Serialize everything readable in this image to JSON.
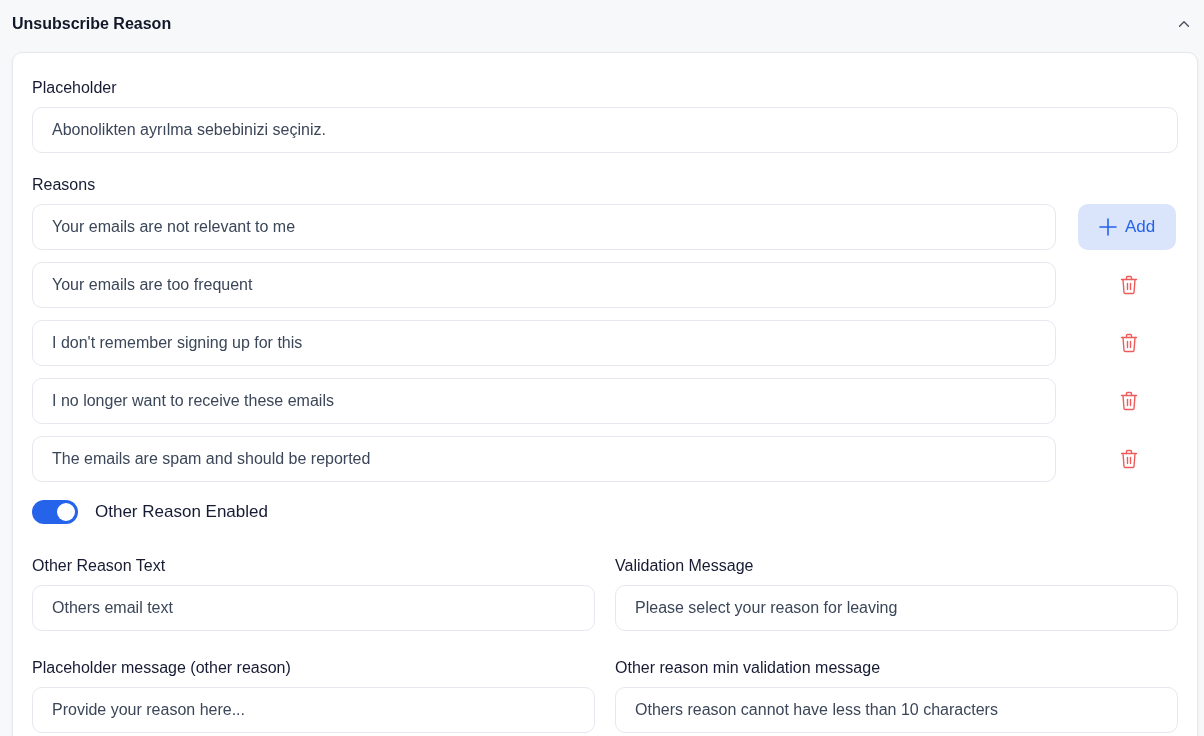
{
  "section": {
    "title": "Unsubscribe Reason",
    "expanded": true
  },
  "placeholder_field": {
    "label": "Placeholder",
    "value": "Abonolikten ayrılma sebebinizi seçiniz."
  },
  "reasons": {
    "label": "Reasons",
    "add_button": "Add",
    "items": [
      {
        "value": "Your emails are not relevant to me"
      },
      {
        "value": "Your emails are too frequent"
      },
      {
        "value": "I don't remember signing up for this"
      },
      {
        "value": "I no longer want to receive these emails"
      },
      {
        "value": "The emails are spam and should be reported"
      }
    ]
  },
  "other_reason_toggle": {
    "label": "Other Reason Enabled",
    "on": true
  },
  "fields": [
    {
      "label": "Other Reason Text",
      "value": "Others email text"
    },
    {
      "label": "Validation Message",
      "value": "Please select your reason for leaving"
    },
    {
      "label": "Placeholder message (other reason)",
      "value": "Provide your reason here..."
    },
    {
      "label": "Other reason min validation message",
      "value": "Others reason cannot have less than 10 characters"
    }
  ]
}
